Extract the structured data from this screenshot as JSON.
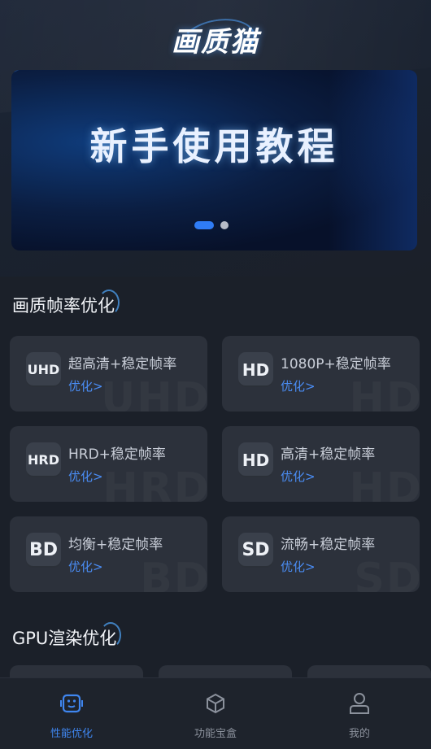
{
  "header": {
    "logo_text": "画质猫"
  },
  "banner": {
    "title": "新手使用教程",
    "active_index": 0,
    "slide_count": 2
  },
  "sections": {
    "quality": {
      "title": "画质帧率优化"
    },
    "gpu": {
      "title": "GPU渲染优化"
    }
  },
  "cards": [
    {
      "badge": "UHD",
      "title": "超高清+稳定帧率",
      "link": "优化>",
      "watermark": "UHD"
    },
    {
      "badge": "HD",
      "title": "1080P+稳定帧率",
      "link": "优化>",
      "watermark": "HD"
    },
    {
      "badge": "HRD",
      "title": "HRD+稳定帧率",
      "link": "优化>",
      "watermark": "HRD"
    },
    {
      "badge": "HD",
      "title": "高清+稳定帧率",
      "link": "优化>",
      "watermark": "HD"
    },
    {
      "badge": "BD",
      "title": "均衡+稳定帧率",
      "link": "优化>",
      "watermark": "BD"
    },
    {
      "badge": "SD",
      "title": "流畅+稳定帧率",
      "link": "优化>",
      "watermark": "SD"
    }
  ],
  "tabbar": {
    "items": [
      {
        "label": "性能优化",
        "icon": "performance-icon",
        "active": true
      },
      {
        "label": "功能宝盒",
        "icon": "toolbox-icon",
        "active": false
      },
      {
        "label": "我的",
        "icon": "profile-icon",
        "active": false
      }
    ],
    "active_color": "#3f86f0",
    "inactive_color": "#8b919c"
  }
}
